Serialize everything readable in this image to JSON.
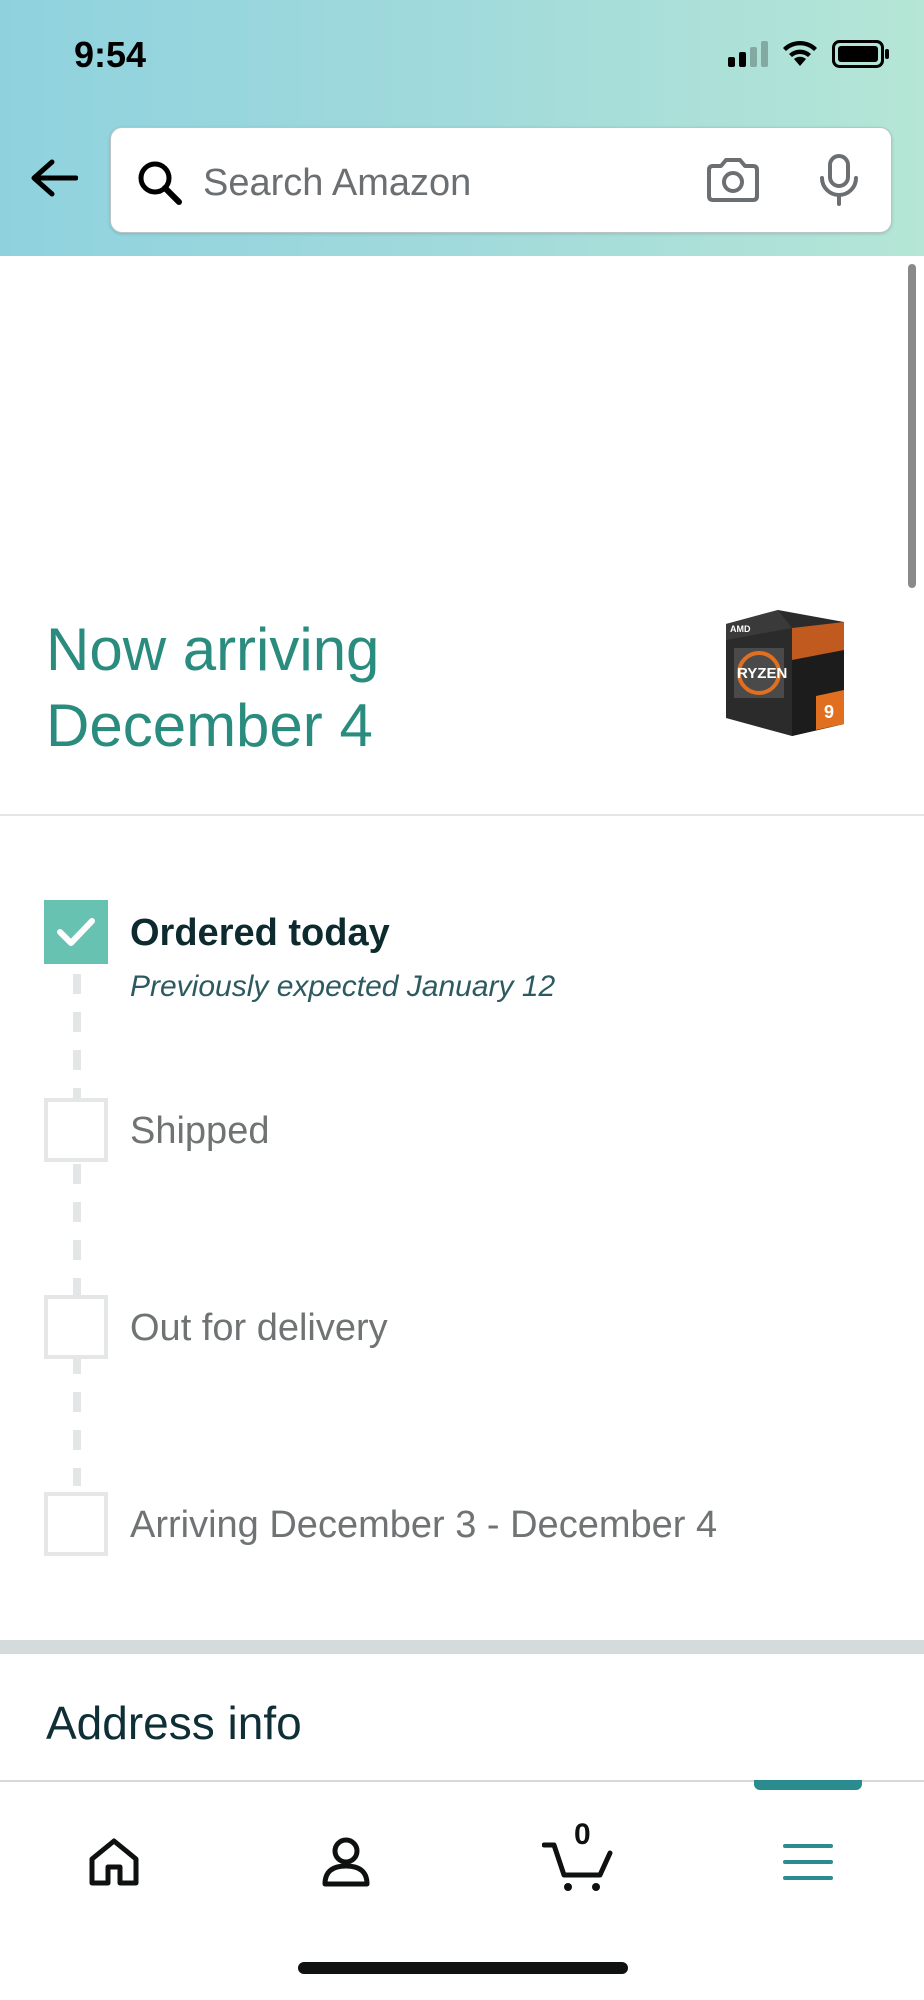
{
  "status_bar": {
    "time": "9:54"
  },
  "search": {
    "placeholder": "Search Amazon"
  },
  "arriving": {
    "line1": "Now arriving",
    "line2": "December 4"
  },
  "timeline": {
    "steps": [
      {
        "label": "Ordered today",
        "sub": "Previously expected January 12",
        "done": true
      },
      {
        "label": "Shipped",
        "done": false
      },
      {
        "label": "Out for delivery",
        "done": false
      },
      {
        "label": "Arriving December 3 - December 4",
        "done": false
      }
    ]
  },
  "address": {
    "title": "Address info"
  },
  "bottom_nav": {
    "cart_count": "0",
    "items": [
      "home-icon",
      "account-icon",
      "cart-icon",
      "menu-icon"
    ]
  },
  "colors": {
    "accent": "#2a8c7e",
    "check": "#67c2b2"
  },
  "product_image": {
    "brand": "AMD",
    "name": "RYZEN",
    "model": "9"
  }
}
